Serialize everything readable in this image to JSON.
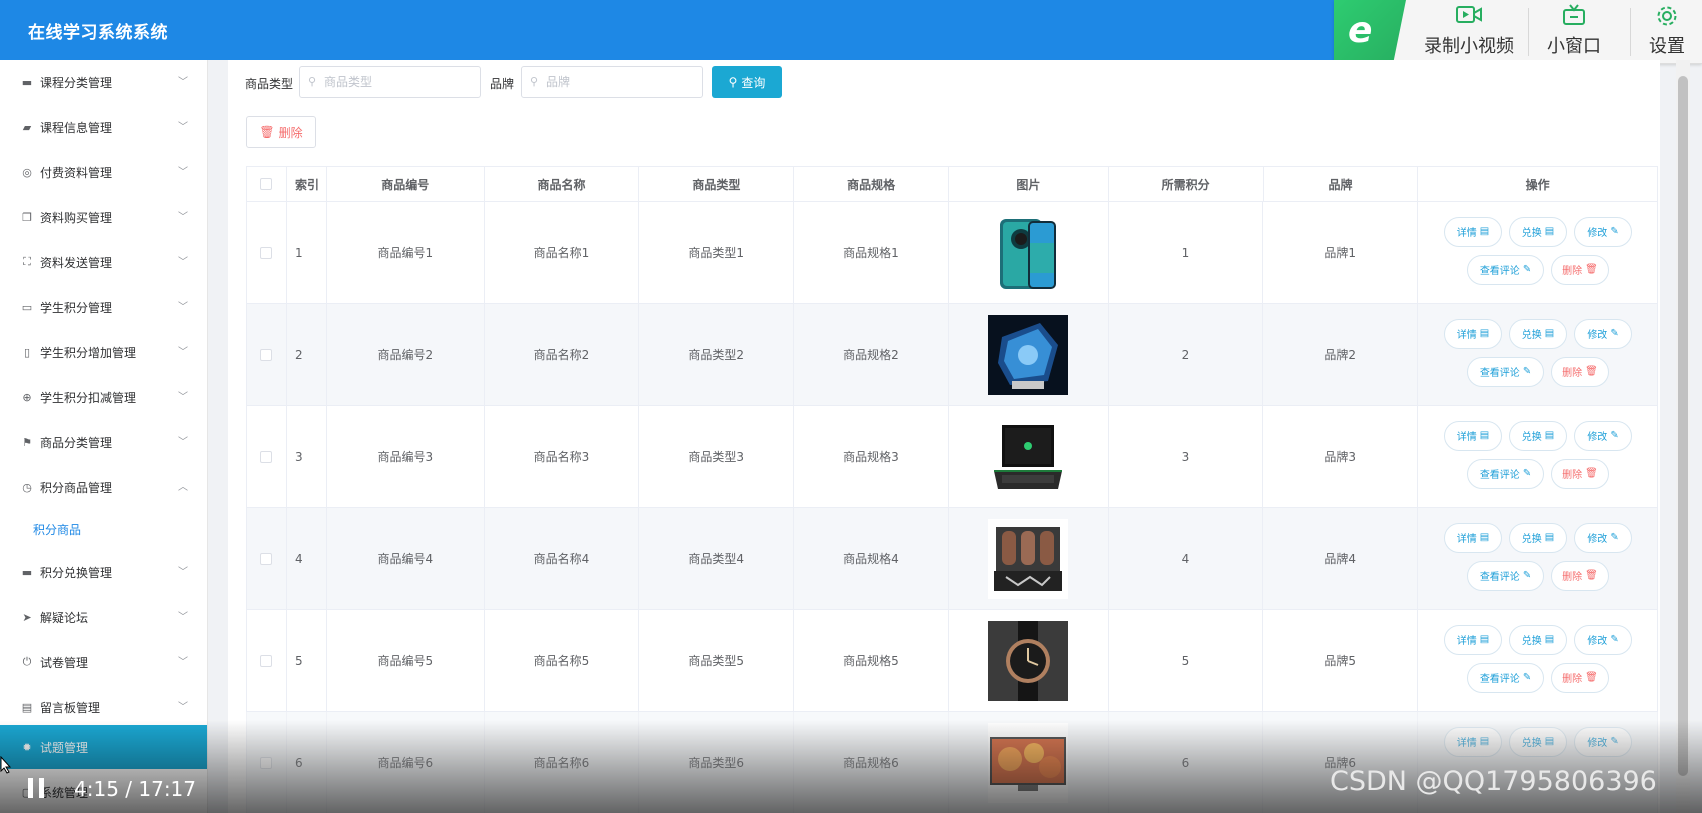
{
  "header": {
    "title": "在线学习系统系统"
  },
  "tool_panel": {
    "record_label": "录制小视频",
    "mini_window_label": "小窗口",
    "settings_label": "设置"
  },
  "sidebar": {
    "items": [
      {
        "label": "课程分类管理",
        "icon": "message-icon"
      },
      {
        "label": "课程信息管理",
        "icon": "thumb-icon"
      },
      {
        "label": "付费资料管理",
        "icon": "compass-icon"
      },
      {
        "label": "资料购买管理",
        "icon": "copy-icon"
      },
      {
        "label": "资料发送管理",
        "icon": "fullscreen-icon"
      },
      {
        "label": "学生积分管理",
        "icon": "tickets-icon"
      },
      {
        "label": "学生积分增加管理",
        "icon": "mic-icon"
      },
      {
        "label": "学生积分扣减管理",
        "icon": "aim-icon"
      },
      {
        "label": "商品分类管理",
        "icon": "flag-icon"
      },
      {
        "label": "积分商品管理",
        "icon": "clock-icon",
        "expanded": true
      },
      {
        "label": "积分兑换管理",
        "icon": "message-icon"
      },
      {
        "label": "解疑论坛",
        "icon": "send-icon"
      },
      {
        "label": "试卷管理",
        "icon": "power-icon"
      },
      {
        "label": "留言板管理",
        "icon": "clipboard-icon"
      },
      {
        "label": "试题管理",
        "icon": "gear-icon",
        "active": true
      },
      {
        "label": "系统管理",
        "icon": "box-icon"
      }
    ],
    "submenu": {
      "label": "积分商品"
    }
  },
  "search": {
    "type_label": "商品类型",
    "type_placeholder": "商品类型",
    "brand_label": "品牌",
    "brand_placeholder": "品牌",
    "query_label": "查询"
  },
  "toolbar": {
    "delete_label": "删除"
  },
  "table": {
    "columns": [
      "索引",
      "商品编号",
      "商品名称",
      "商品类型",
      "商品规格",
      "图片",
      "所需积分",
      "品牌",
      "操作"
    ],
    "rows": [
      {
        "index": "1",
        "number": "商品编号1",
        "name": "商品名称1",
        "type": "商品类型1",
        "spec": "商品规格1",
        "points": "1",
        "brand": "品牌1",
        "image": "smartphone"
      },
      {
        "index": "2",
        "number": "商品编号2",
        "name": "商品名称2",
        "type": "商品类型2",
        "spec": "商品规格2",
        "points": "2",
        "brand": "品牌2",
        "image": "gaming-pc"
      },
      {
        "index": "3",
        "number": "商品编号3",
        "name": "商品名称3",
        "type": "商品类型3",
        "spec": "商品规格3",
        "points": "3",
        "brand": "品牌3",
        "image": "laptop"
      },
      {
        "index": "4",
        "number": "商品编号4",
        "name": "商品名称4",
        "type": "商品类型4",
        "spec": "商品规格4",
        "points": "4",
        "brand": "品牌4",
        "image": "tube-amplifier"
      },
      {
        "index": "5",
        "number": "商品编号5",
        "name": "商品名称5",
        "type": "商品类型5",
        "spec": "商品规格5",
        "points": "5",
        "brand": "品牌5",
        "image": "wristwatch"
      },
      {
        "index": "6",
        "number": "商品编号6",
        "name": "商品名称6",
        "type": "商品类型6",
        "spec": "商品规格6",
        "points": "6",
        "brand": "品牌6",
        "image": "television"
      }
    ],
    "actions": {
      "detail": "详情",
      "exchange": "兑换",
      "edit": "修改",
      "comments": "查看评论",
      "delete": "删除"
    }
  },
  "video": {
    "time": "4:15 / 17:17"
  },
  "watermark": {
    "text": "CSDN @QQ1795806396"
  },
  "colors": {
    "header": "#1e88e5",
    "accent": "#1ba8d3",
    "danger": "#f56c6c"
  }
}
